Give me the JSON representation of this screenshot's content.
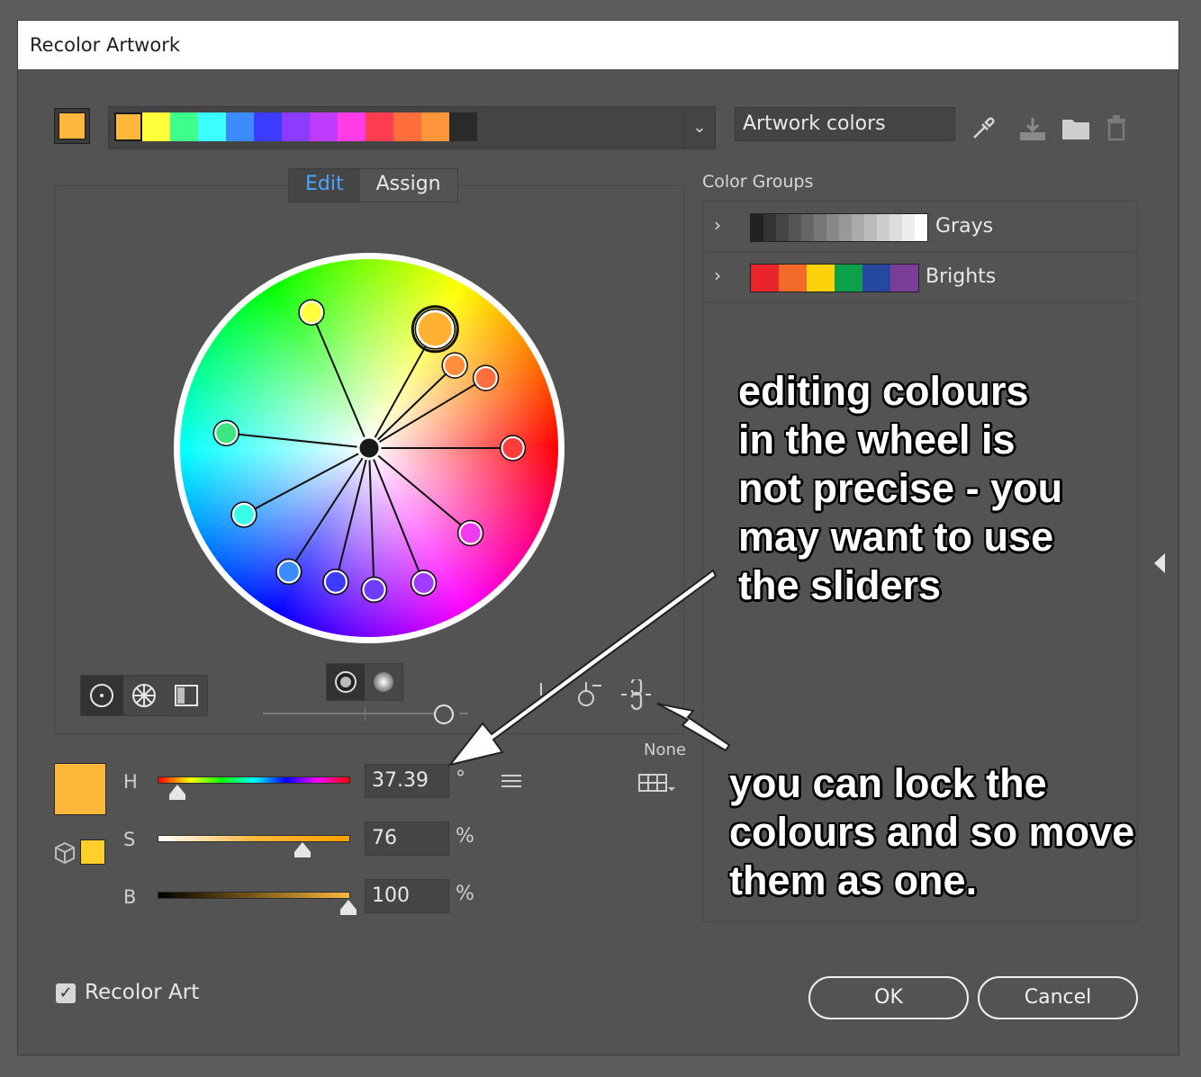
{
  "window": {
    "title": "Recolor Artwork"
  },
  "current_color": "#FDB83C",
  "color_strip": {
    "colors": [
      "#FDB83C",
      "#FFFF3C",
      "#3CFF8C",
      "#3CFFFF",
      "#3C8CFF",
      "#3C3CFF",
      "#8C3CFF",
      "#BE3CFF",
      "#FF3CE6",
      "#FF3C50",
      "#FF6E3C",
      "#FF963C",
      "#2A2A2A"
    ],
    "selected_index": 0
  },
  "group_name": {
    "value": "Artwork colors"
  },
  "tabs": [
    {
      "label": "Edit",
      "active": true
    },
    {
      "label": "Assign",
      "active": false
    }
  ],
  "wheel": {
    "center_color": "#1a1a1a",
    "handles": [
      {
        "color": "#FFB232",
        "primary": true
      },
      {
        "color": "#FFFF3C"
      },
      {
        "color": "#FF8F3C"
      },
      {
        "color": "#FF6E3C"
      },
      {
        "color": "#FF3C3C"
      },
      {
        "color": "#3CE680"
      },
      {
        "color": "#3CFFEA"
      },
      {
        "color": "#3C8CFF"
      },
      {
        "color": "#3C3CFF"
      },
      {
        "color": "#6E3CFF"
      },
      {
        "color": "#A03CFF"
      },
      {
        "color": "#F03CF0"
      }
    ]
  },
  "color_groups": {
    "label": "Color Groups",
    "groups": [
      {
        "name": "Grays",
        "swatches": [
          "#222222",
          "#333333",
          "#444444",
          "#555555",
          "#666666",
          "#777777",
          "#888888",
          "#999999",
          "#aaaaaa",
          "#bbbbbb",
          "#cccccc",
          "#dddddd",
          "#eeeeee",
          "#ffffff"
        ]
      },
      {
        "name": "Brights",
        "swatches": [
          "#E9242C",
          "#F26B28",
          "#FDD20B",
          "#0DA04A",
          "#26489E",
          "#7A3E97"
        ]
      }
    ]
  },
  "harmony": {
    "none_label": "None"
  },
  "sliders": {
    "swatch_color": "#FDB83C",
    "small_swatch_color": "#FFD02C",
    "h": {
      "label": "H",
      "value": "37.39",
      "unit": "°",
      "fraction": 0.104
    },
    "s": {
      "label": "S",
      "value": "76",
      "unit": "%",
      "fraction": 0.76
    },
    "b": {
      "label": "B",
      "value": "100",
      "unit": "%",
      "fraction": 1.0
    }
  },
  "recolor_art": {
    "label": "Recolor Art",
    "checked": true
  },
  "buttons": {
    "ok": "OK",
    "cancel": "Cancel"
  },
  "annotations": {
    "wheel_note": "editing colours\nin the wheel is\nnot precise - you\nmay want to use\nthe sliders",
    "lock_note": "you can lock the\ncolours and so move\nthem as one."
  },
  "icons": [
    "eyedropper-icon",
    "save-group-icon",
    "folder-icon",
    "trash-icon",
    "chevron-down-icon",
    "collapse-arrow-icon",
    "link-icon",
    "harmony-grid-icon",
    "cube-icon"
  ]
}
